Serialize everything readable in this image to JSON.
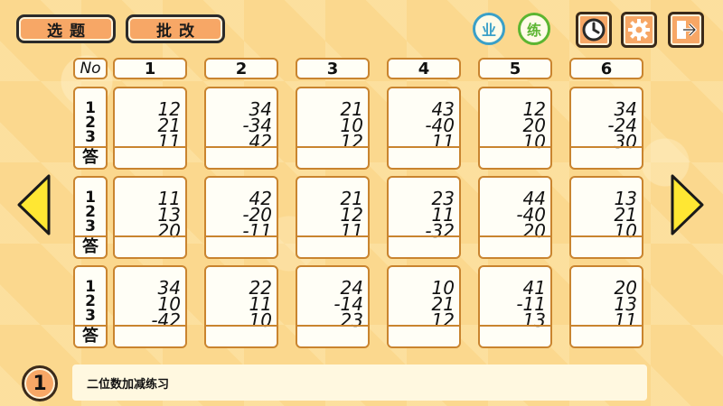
{
  "toolbar": {
    "select_label": "选题",
    "grade_label": "批改",
    "ye_label": "业",
    "lian_label": "练",
    "icons": [
      "clock-icon",
      "gear-icon",
      "exit-icon"
    ]
  },
  "header": {
    "no_label": "No",
    "columns": [
      "1",
      "2",
      "3",
      "4",
      "5",
      "6"
    ]
  },
  "row_labels": {
    "nums": [
      "1",
      "2",
      "3"
    ],
    "answer": "答"
  },
  "problems": [
    [
      [
        "12",
        "21",
        "11"
      ],
      [
        "34",
        "-34",
        "42"
      ],
      [
        "21",
        "10",
        "12"
      ],
      [
        "43",
        "-40",
        "11"
      ],
      [
        "12",
        "20",
        "10"
      ],
      [
        "34",
        "-24",
        "30"
      ]
    ],
    [
      [
        "11",
        "13",
        "20"
      ],
      [
        "42",
        "-20",
        "-11"
      ],
      [
        "21",
        "12",
        "11"
      ],
      [
        "23",
        "11",
        "-32"
      ],
      [
        "44",
        "-40",
        "20"
      ],
      [
        "13",
        "21",
        "10"
      ]
    ],
    [
      [
        "34",
        "10",
        "-42"
      ],
      [
        "22",
        "11",
        "10"
      ],
      [
        "24",
        "-14",
        "23"
      ],
      [
        "10",
        "21",
        "12"
      ],
      [
        "41",
        "-11",
        "13"
      ],
      [
        "20",
        "13",
        "11"
      ]
    ]
  ],
  "footer": {
    "page_number": "1",
    "title": "二位数加减练习"
  },
  "colors": {
    "background": "#fbd88e",
    "button_orange": "#f7a766",
    "cell_border": "#c9842f",
    "arrow_yellow": "#ffe733",
    "ye_blue": "#3aa0c8",
    "lian_green": "#5cb531"
  }
}
